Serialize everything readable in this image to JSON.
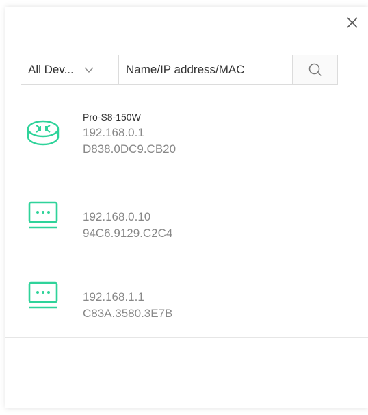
{
  "dialog": {
    "close_icon": "close-icon"
  },
  "search": {
    "filter_selected": "All Dev...",
    "placeholder": "Name/IP address/MAC",
    "value": "",
    "search_icon": "search-icon",
    "chevron_icon": "chevron-down-icon"
  },
  "devices": [
    {
      "name": "Pro-S8-150W",
      "ip": "192.168.0.1",
      "mac": "D838.0DC9.CB20",
      "icon": "router-icon"
    },
    {
      "name": "",
      "ip": "192.168.0.10",
      "mac": "94C6.9129.C2C4",
      "icon": "switch-icon"
    },
    {
      "name": "",
      "ip": "192.168.1.1",
      "mac": "C83A.3580.3E7B",
      "icon": "switch-icon"
    }
  ],
  "colors": {
    "accent": "#2fd39a",
    "text_primary": "#333333",
    "text_secondary": "#888888",
    "border": "#dcdcdc"
  }
}
